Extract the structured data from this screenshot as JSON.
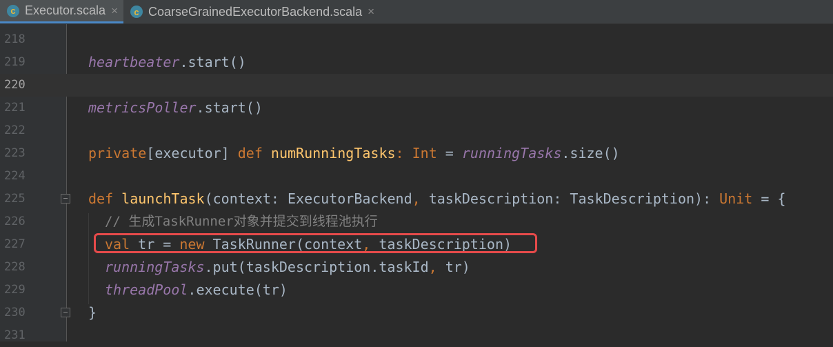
{
  "tabs": [
    {
      "label": "Executor.scala",
      "icon": "scala-class-icon",
      "active": true
    },
    {
      "label": "CoarseGrainedExecutorBackend.scala",
      "icon": "scala-class-icon",
      "active": false
    }
  ],
  "tab_close_glyph": "×",
  "file_icon_letter": "c",
  "lines": [
    {
      "num": "218"
    },
    {
      "num": "219",
      "field": "heartbeater",
      "rest": ".start()"
    },
    {
      "num": "220"
    },
    {
      "num": "221",
      "field": "metricsPoller",
      "rest": ".start()"
    },
    {
      "num": "222"
    },
    {
      "num": "223",
      "kw1": "private",
      "p1": "[executor] ",
      "kw2": "def",
      "fn": "numRunningTasks",
      "p2": ": ",
      "type": "Int",
      "p3": " = ",
      "field": "runningTasks",
      "p4": ".size()"
    },
    {
      "num": "224"
    },
    {
      "num": "225",
      "kw1": "def",
      "fn": "launchTask",
      "p1": "(context: ExecutorBackend",
      "comma": ",",
      "p2": " taskDescription: TaskDescription): ",
      "type": "Unit",
      "p3": " = {"
    },
    {
      "num": "226",
      "comment": "// 生成TaskRunner对象并提交到线程池执行"
    },
    {
      "num": "227",
      "kw1": "val",
      "p1": " tr = ",
      "kw2": "new",
      "p2": " TaskRunner(context",
      "comma": ",",
      "p3": " taskDescription)"
    },
    {
      "num": "228",
      "field": "runningTasks",
      "p1": ".put(taskDescription.taskId",
      "comma": ",",
      "p2": " tr)"
    },
    {
      "num": "229",
      "field": "threadPool",
      "p1": ".execute(tr)"
    },
    {
      "num": "230",
      "p1": "}"
    },
    {
      "num": "231"
    }
  ],
  "colors": {
    "keyword": "#cc7832",
    "field": "#9876aa",
    "function": "#ffc66d",
    "comment": "#808080",
    "text": "#a9b7c6",
    "highlight_box": "#e64a4a"
  }
}
